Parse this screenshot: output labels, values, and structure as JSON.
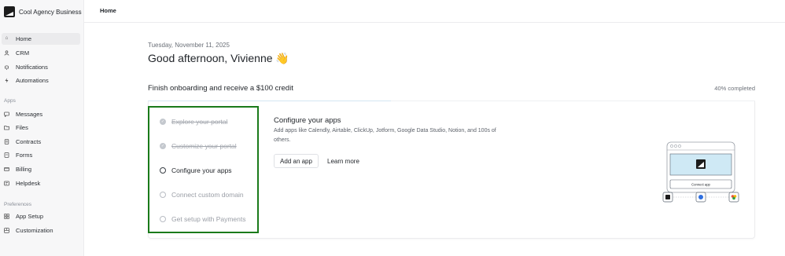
{
  "sidebar": {
    "brand_name": "Cool Agency Business",
    "main_items": [
      {
        "label": "Home",
        "icon": "home-icon"
      },
      {
        "label": "CRM",
        "icon": "contacts-icon"
      },
      {
        "label": "Notifications",
        "icon": "bell-icon"
      },
      {
        "label": "Automations",
        "icon": "bolt-icon"
      }
    ],
    "apps_section": "Apps",
    "apps_items": [
      {
        "label": "Messages",
        "icon": "message-icon"
      },
      {
        "label": "Files",
        "icon": "folder-icon"
      },
      {
        "label": "Contracts",
        "icon": "contract-icon"
      },
      {
        "label": "Forms",
        "icon": "form-icon"
      },
      {
        "label": "Billing",
        "icon": "billing-icon"
      },
      {
        "label": "Helpdesk",
        "icon": "helpdesk-icon"
      }
    ],
    "prefs_section": "Preferences",
    "prefs_items": [
      {
        "label": "App Setup",
        "icon": "app-setup-icon"
      },
      {
        "label": "Customization",
        "icon": "customization-icon"
      }
    ]
  },
  "header": {
    "title": "Home"
  },
  "main": {
    "date": "Tuesday, November 11, 2025",
    "greeting": "Good afternoon, Vivienne 👋",
    "onboarding": {
      "title": "Finish onboarding and receive a $100 credit",
      "progress_label": "40% completed",
      "progress_value": 0.4,
      "steps": [
        {
          "label": "Explore your portal",
          "status": "done"
        },
        {
          "label": "Customize your portal",
          "status": "done"
        },
        {
          "label": "Configure your apps",
          "status": "current"
        },
        {
          "label": "Connect custom domain",
          "status": "todo"
        },
        {
          "label": "Get setup with Payments",
          "status": "todo"
        }
      ],
      "detail": {
        "title": "Configure your apps",
        "description": "Add apps like Calendly, Airtable, ClickUp, Jotform, Google Data Studio, Notion, and 100s of others.",
        "primary_button": "Add an app",
        "secondary_link": "Learn more",
        "illustration_button": "Connect app"
      }
    }
  },
  "colors": {
    "highlight_border": "#1a7a1a",
    "illustration_accent": "#cfe9f5",
    "progress_fill": "#d4e6f3"
  }
}
